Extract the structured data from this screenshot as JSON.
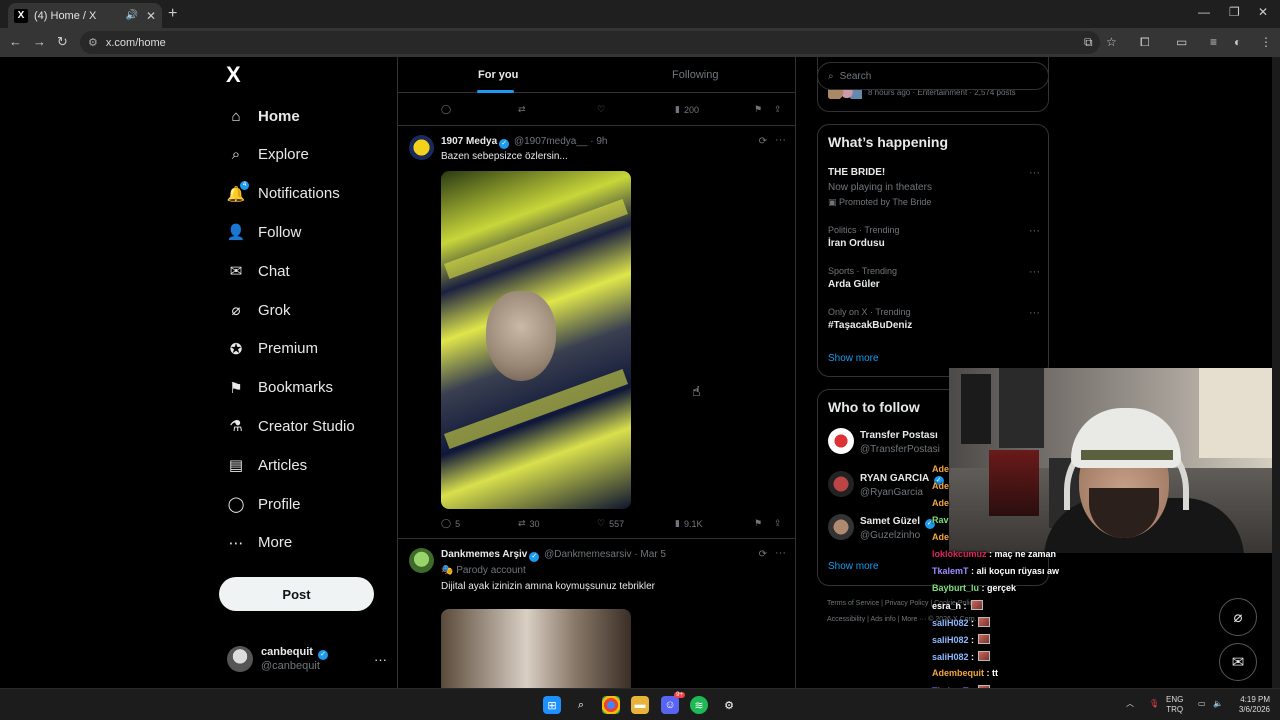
{
  "browser": {
    "tab_title": "(4) Home / X",
    "tab_favicon": "X",
    "url": "x.com/home"
  },
  "nav": {
    "logo": "X",
    "items": [
      {
        "label": "Home",
        "icon": "home-icon"
      },
      {
        "label": "Explore",
        "icon": "search-icon"
      },
      {
        "label": "Notifications",
        "icon": "bell-icon",
        "badge": "4"
      },
      {
        "label": "Follow",
        "icon": "person-plus-icon"
      },
      {
        "label": "Chat",
        "icon": "mail-icon"
      },
      {
        "label": "Grok",
        "icon": "grok-icon"
      },
      {
        "label": "Premium",
        "icon": "premium-icon"
      },
      {
        "label": "Bookmarks",
        "icon": "bookmark-icon"
      },
      {
        "label": "Creator Studio",
        "icon": "flask-icon"
      },
      {
        "label": "Articles",
        "icon": "article-icon"
      },
      {
        "label": "Profile",
        "icon": "person-icon"
      },
      {
        "label": "More",
        "icon": "more-circle-icon"
      }
    ],
    "post_label": "Post",
    "account": {
      "name": "canbequit",
      "handle": "@canbequit"
    }
  },
  "feed": {
    "tabs": [
      "For you",
      "Following"
    ],
    "prev_views": "200",
    "tweets": [
      {
        "name": "1907 Medya",
        "handle": "@1907medya__",
        "time": "· 9h",
        "text": "Bazen sebepsizce özlersin...",
        "replies": "5",
        "reposts": "30",
        "likes": "557",
        "views": "9.1K"
      },
      {
        "name": "Dankmemes Arşiv",
        "handle": "@Dankmemesarsiv",
        "time": "· Mar 5",
        "label": "Parody account",
        "text": "Dijital ayak izinizin amına koymuşsunuz tebrikler"
      }
    ]
  },
  "right": {
    "search_placeholder": "Search",
    "top_meta": "8 hours ago · Entertainment · 2,574 posts",
    "happening_title": "What’s happening",
    "trends": [
      {
        "title": "THE BRIDE!",
        "sub": "Now playing in theaters",
        "promo": "Promoted by The Bride"
      },
      {
        "cat": "Politics · Trending",
        "title": "İran Ordusu"
      },
      {
        "cat": "Sports · Trending",
        "title": "Arda Güler"
      },
      {
        "cat": "Only on X · Trending",
        "title": "#TaşacakBuDeniz"
      }
    ],
    "show_more": "Show more",
    "wtf_title": "Who to follow",
    "follow": [
      {
        "name": "Transfer Postası",
        "handle": "@TransferPostasi"
      },
      {
        "name": "RYAN GARCIA",
        "handle": "@RyanGarcia"
      },
      {
        "name": "Samet Güzel",
        "handle": "@Guzelzinho"
      }
    ],
    "footer1": "Terms of Service  |  Privacy Policy  |  Cookie Policy  |",
    "footer2": "Accessibility  |  Ads info  |  More ···  © 2026 X Corp."
  },
  "chat": [
    {
      "user": "Ade",
      "msg": "",
      "color": "#f2a640"
    },
    {
      "user": "Ade",
      "msg": "",
      "color": "#f2a640"
    },
    {
      "user": "Ade",
      "msg": "",
      "color": "#f2a640"
    },
    {
      "user": "Rav",
      "msg": "",
      "color": "#7be07b"
    },
    {
      "user": "Ade",
      "msg": "",
      "color": "#f2a640"
    },
    {
      "user": "loklokcumuz",
      "msg": ": maç ne zaman",
      "color": "#e0245e"
    },
    {
      "user": "TkalemT",
      "msg": ": ali koçun rüyası aw",
      "color": "#9f8cff"
    },
    {
      "user": "Bayburt_lu",
      "msg": ": gerçek",
      "color": "#7be07b"
    },
    {
      "user": "esra_h",
      "msg": ":",
      "color": "#ffffff",
      "emote": true
    },
    {
      "user": "saliH082",
      "msg": ":",
      "color": "#8fb8ff",
      "emote": true
    },
    {
      "user": "saliH082",
      "msg": ":",
      "color": "#8fb8ff",
      "emote": true
    },
    {
      "user": "saliH082",
      "msg": ":",
      "color": "#8fb8ff",
      "emote": true
    },
    {
      "user": "Adembequit",
      "msg": ": tt",
      "color": "#f2a640"
    },
    {
      "user": "TkalemT",
      "msg": ":",
      "color": "#9f8cff",
      "emote": true
    },
    {
      "user": "Adembequit",
      "msg": ": tt",
      "color": "#f2a640"
    }
  ],
  "taskbar": {
    "lang1": "ENG",
    "lang2": "TRQ",
    "time": "4:19 PM",
    "date": "3/6/2026",
    "discord_badge": "9+"
  },
  "colors": {
    "accent": "#1d9bf0",
    "background": "#000000",
    "border": "#2f3336",
    "muted": "#71767b"
  }
}
